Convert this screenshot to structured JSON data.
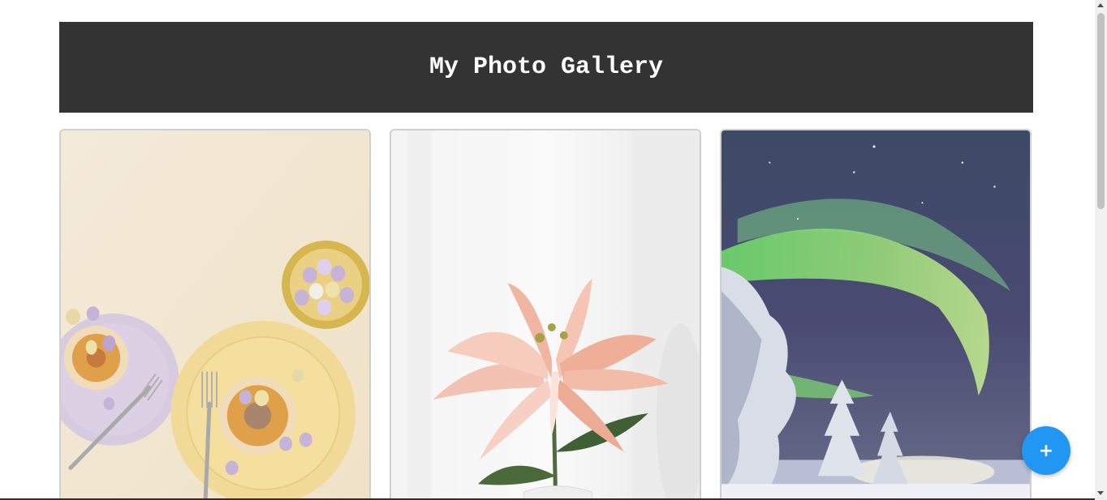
{
  "header": {
    "title": "My Photo Gallery"
  },
  "gallery": {
    "photos": [
      {
        "subject": "easter-tarts-photo"
      },
      {
        "subject": "pink-lily-photo"
      },
      {
        "subject": "northern-lights-photo"
      }
    ]
  },
  "fab": {
    "label": "+"
  },
  "colors": {
    "header_bg": "#333333",
    "header_text": "#ffffff",
    "fab_bg": "#2196f3"
  }
}
